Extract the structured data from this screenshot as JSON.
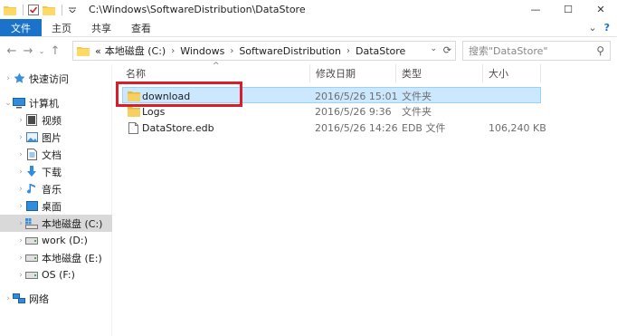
{
  "window": {
    "title": "C:\\Windows\\SoftwareDistribution\\DataStore",
    "controls": {
      "minimize": "—",
      "maximize": "☐",
      "close": "✕"
    }
  },
  "ribbon": {
    "tabs": [
      "文件",
      "主页",
      "共享",
      "查看"
    ],
    "expand": "⌄",
    "help": "?"
  },
  "address": {
    "prefix": "«",
    "crumbs": [
      "本地磁盘 (C:)",
      "Windows",
      "SoftwareDistribution",
      "DataStore"
    ],
    "search_placeholder": "搜索\"DataStore\""
  },
  "nav": {
    "items": [
      {
        "label": "快速访问",
        "icon": "star-icon",
        "level": 0,
        "expand": "›"
      },
      {
        "label": "计算机",
        "icon": "computer-icon",
        "level": 0,
        "expand": "⌄"
      },
      {
        "label": "视频",
        "icon": "video-icon",
        "level": 1,
        "expand": "›"
      },
      {
        "label": "图片",
        "icon": "picture-icon",
        "level": 1,
        "expand": "›"
      },
      {
        "label": "文档",
        "icon": "document-icon",
        "level": 1,
        "expand": "›"
      },
      {
        "label": "下载",
        "icon": "download-icon",
        "level": 1,
        "expand": "›"
      },
      {
        "label": "音乐",
        "icon": "music-icon",
        "level": 1,
        "expand": "›"
      },
      {
        "label": "桌面",
        "icon": "desktop-icon",
        "level": 1,
        "expand": "›"
      },
      {
        "label": "本地磁盘 (C:)",
        "icon": "system-drive-icon",
        "level": 1,
        "expand": "›",
        "selected": true
      },
      {
        "label": "work (D:)",
        "icon": "drive-icon",
        "level": 1,
        "expand": "›"
      },
      {
        "label": "本地磁盘 (E:)",
        "icon": "drive-icon",
        "level": 1,
        "expand": "›"
      },
      {
        "label": "OS (F:)",
        "icon": "drive-icon",
        "level": 1,
        "expand": "›"
      },
      {
        "label": "网络",
        "icon": "network-icon",
        "level": 0,
        "expand": "›"
      }
    ]
  },
  "table": {
    "columns": [
      "名称",
      "修改日期",
      "类型",
      "大小"
    ],
    "rows": [
      {
        "name": "download",
        "date": "2016/5/26 15:01",
        "type": "文件夹",
        "size": "",
        "icon": "folder-icon",
        "selected": true
      },
      {
        "name": "Logs",
        "date": "2016/5/26 9:36",
        "type": "文件夹",
        "size": "",
        "icon": "folder-icon"
      },
      {
        "name": "DataStore.edb",
        "date": "2016/5/26 14:26",
        "type": "EDB 文件",
        "size": "106,240 KB",
        "icon": "file-icon"
      }
    ]
  },
  "colors": {
    "accent": "#1a73c8",
    "selection": "#cce8ff",
    "highlight_box": "#d81e2b",
    "folder": "#f3c94a"
  }
}
